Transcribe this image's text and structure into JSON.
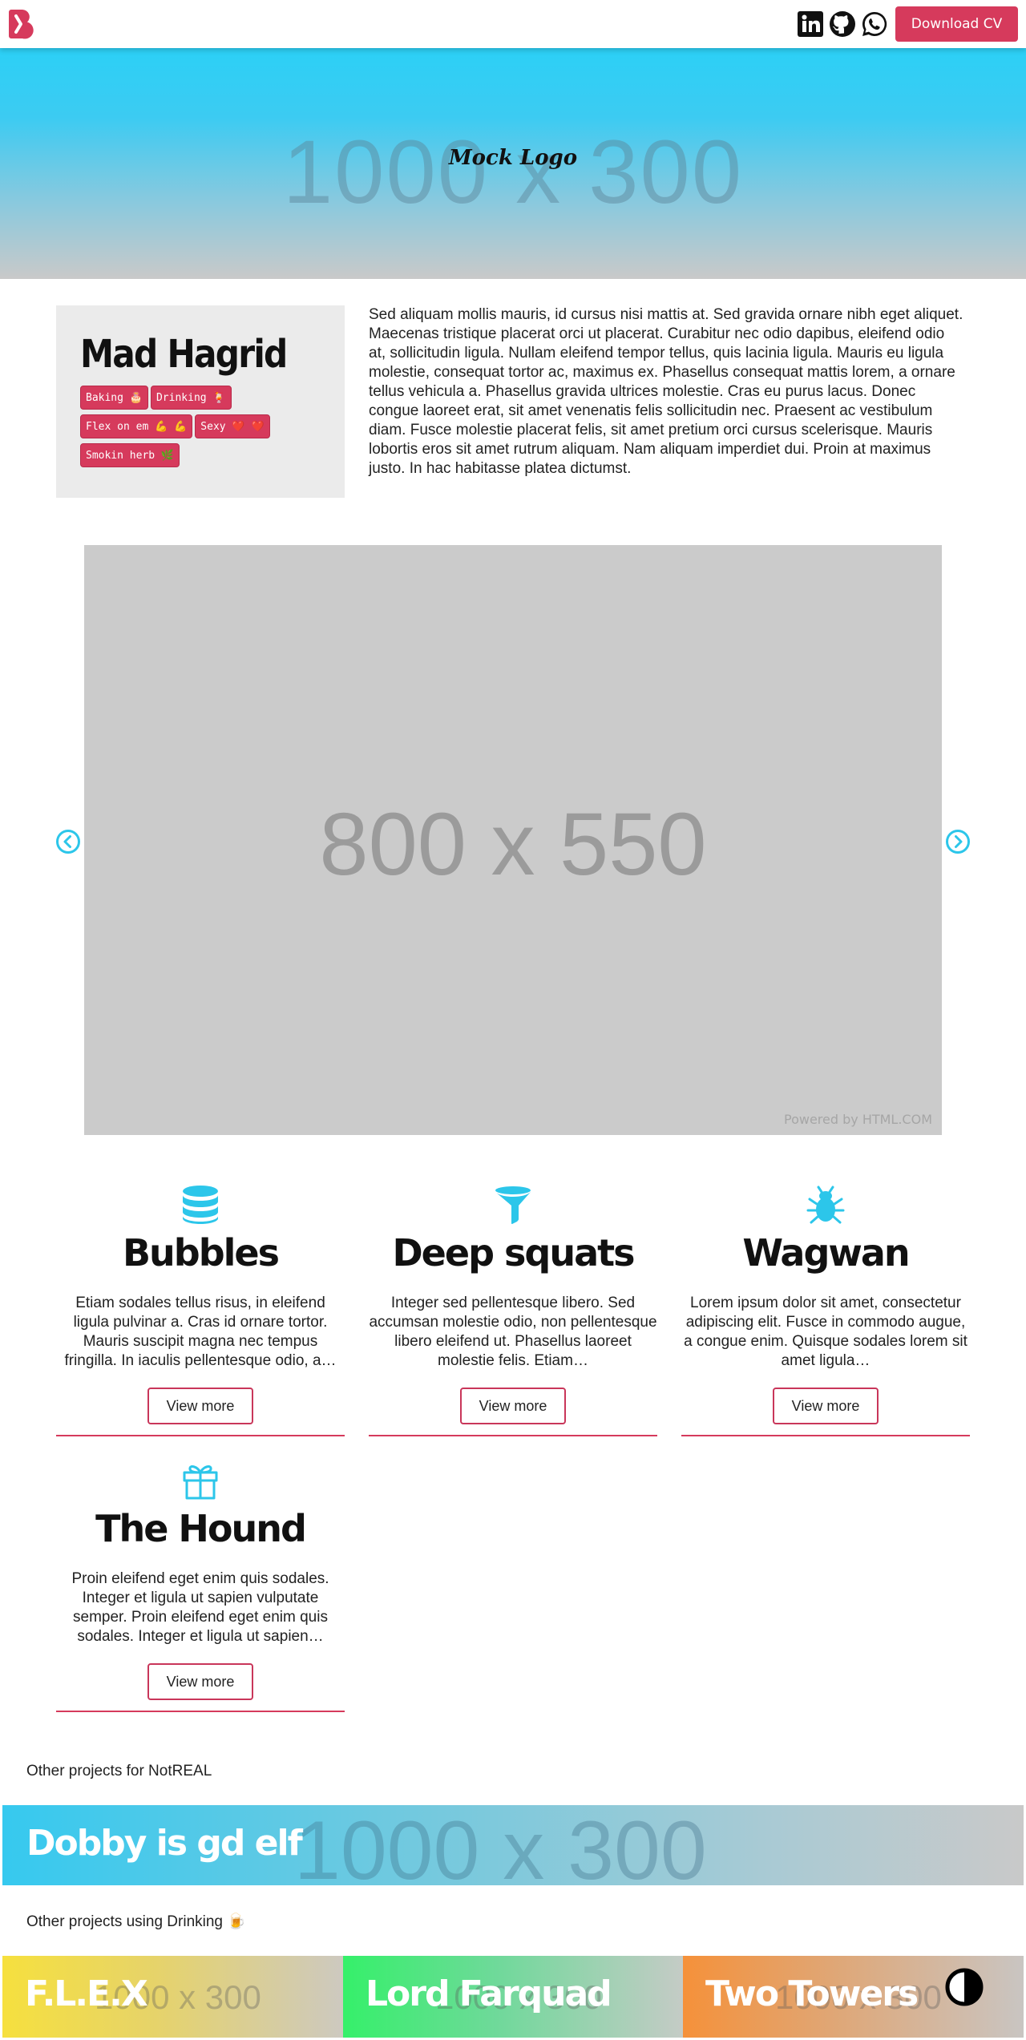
{
  "nav": {
    "logo_icon": "brand-b-icon",
    "social": [
      {
        "name": "linkedin-icon"
      },
      {
        "name": "github-icon"
      },
      {
        "name": "whatsapp-icon"
      }
    ],
    "cta_label": "Download CV",
    "accent": "#d63a5c"
  },
  "hero": {
    "placeholder": "1000 x 300",
    "logo_text": "Mock Logo",
    "gradient": [
      "#2cd0f6",
      "#c9c9c9"
    ]
  },
  "about": {
    "name": "Mad Hagrid",
    "tags": [
      "Baking 🎂",
      "Drinking 🍹",
      "Flex on em 💪 💪",
      "Sexy ❤️ ❤️",
      "Smokin herb 🌿"
    ],
    "bio": "Sed aliquam mollis mauris, id cursus nisi mattis at. Sed gravida ornare nibh eget aliquet. Maecenas tristique placerat orci ut placerat. Curabitur nec odio dapibus, eleifend odio at, sollicitudin ligula. Nullam eleifend tempor tellus, quis lacinia ligula. Mauris eu ligula molestie, consequat tortor ac, maximus ex. Phasellus consequat mattis lorem, a ornare tellus vehicula a. Phasellus gravida ultrices molestie. Cras eu purus lacus. Donec congue laoreet erat, sit amet venenatis felis sollicitudin nec. Praesent ac vestibulum diam. Fusce molestie placerat felis, sit amet pretium orci cursus scelerisque. Mauris lobortis eros sit amet rutrum aliquam. Nam aliquam imperdiet dui. Proin at maximus justo. In hac habitasse platea dictumst."
  },
  "carousel": {
    "placeholder": "800 x 550",
    "credit": "Powered by HTML.COM",
    "prev_icon": "chevron-left-circle-icon",
    "next_icon": "chevron-right-circle-icon",
    "icon_color": "#2cc6ea"
  },
  "features": [
    {
      "icon": "database-icon",
      "title": "Bubbles",
      "text": "Etiam sodales tellus risus, in eleifend ligula pulvinar a. Cras id ornare tortor. Mauris suscipit magna nec tempus fringilla. In iaculis pellentesque odio, a…",
      "button": "View more"
    },
    {
      "icon": "funnel-icon",
      "title": "Deep squats",
      "text": "Integer sed pellentesque libero. Sed accumsan molestie odio, non pellentesque libero eleifend ut. Phasellus laoreet molestie felis. Etiam…",
      "button": "View more"
    },
    {
      "icon": "bug-icon",
      "title": "Wagwan",
      "text": "Lorem ipsum dolor sit amet, consectetur adipiscing elit. Fusce in commodo augue, a congue enim. Quisque sodales lorem sit amet ligula…",
      "button": "View more"
    },
    {
      "icon": "gift-icon",
      "title": "The Hound",
      "text": "Proin eleifend eget enim quis sodales. Integer et ligula ut sapien vulputate semper. Proin eleifend eget enim quis sodales. Integer et ligula ut sapien…",
      "button": "View more"
    }
  ],
  "other_projects": {
    "label_company": "Other projects for NotREAL",
    "company_banner": {
      "title": "Dobby is gd elf",
      "placeholder": "1000 x 300"
    },
    "label_skill": "Other projects using Drinking 🍺",
    "skill_banners": [
      {
        "title": "F.L.E.X",
        "placeholder": "1000 x 300",
        "color": "#f6e03e"
      },
      {
        "title": "Lord Farquad",
        "placeholder": "1000 x 300",
        "color": "#35f06a"
      },
      {
        "title": "Two Towers",
        "placeholder": "1000 x 300",
        "color": "#f5913a"
      }
    ]
  },
  "theme_toggle_icon": "contrast-toggle-icon"
}
